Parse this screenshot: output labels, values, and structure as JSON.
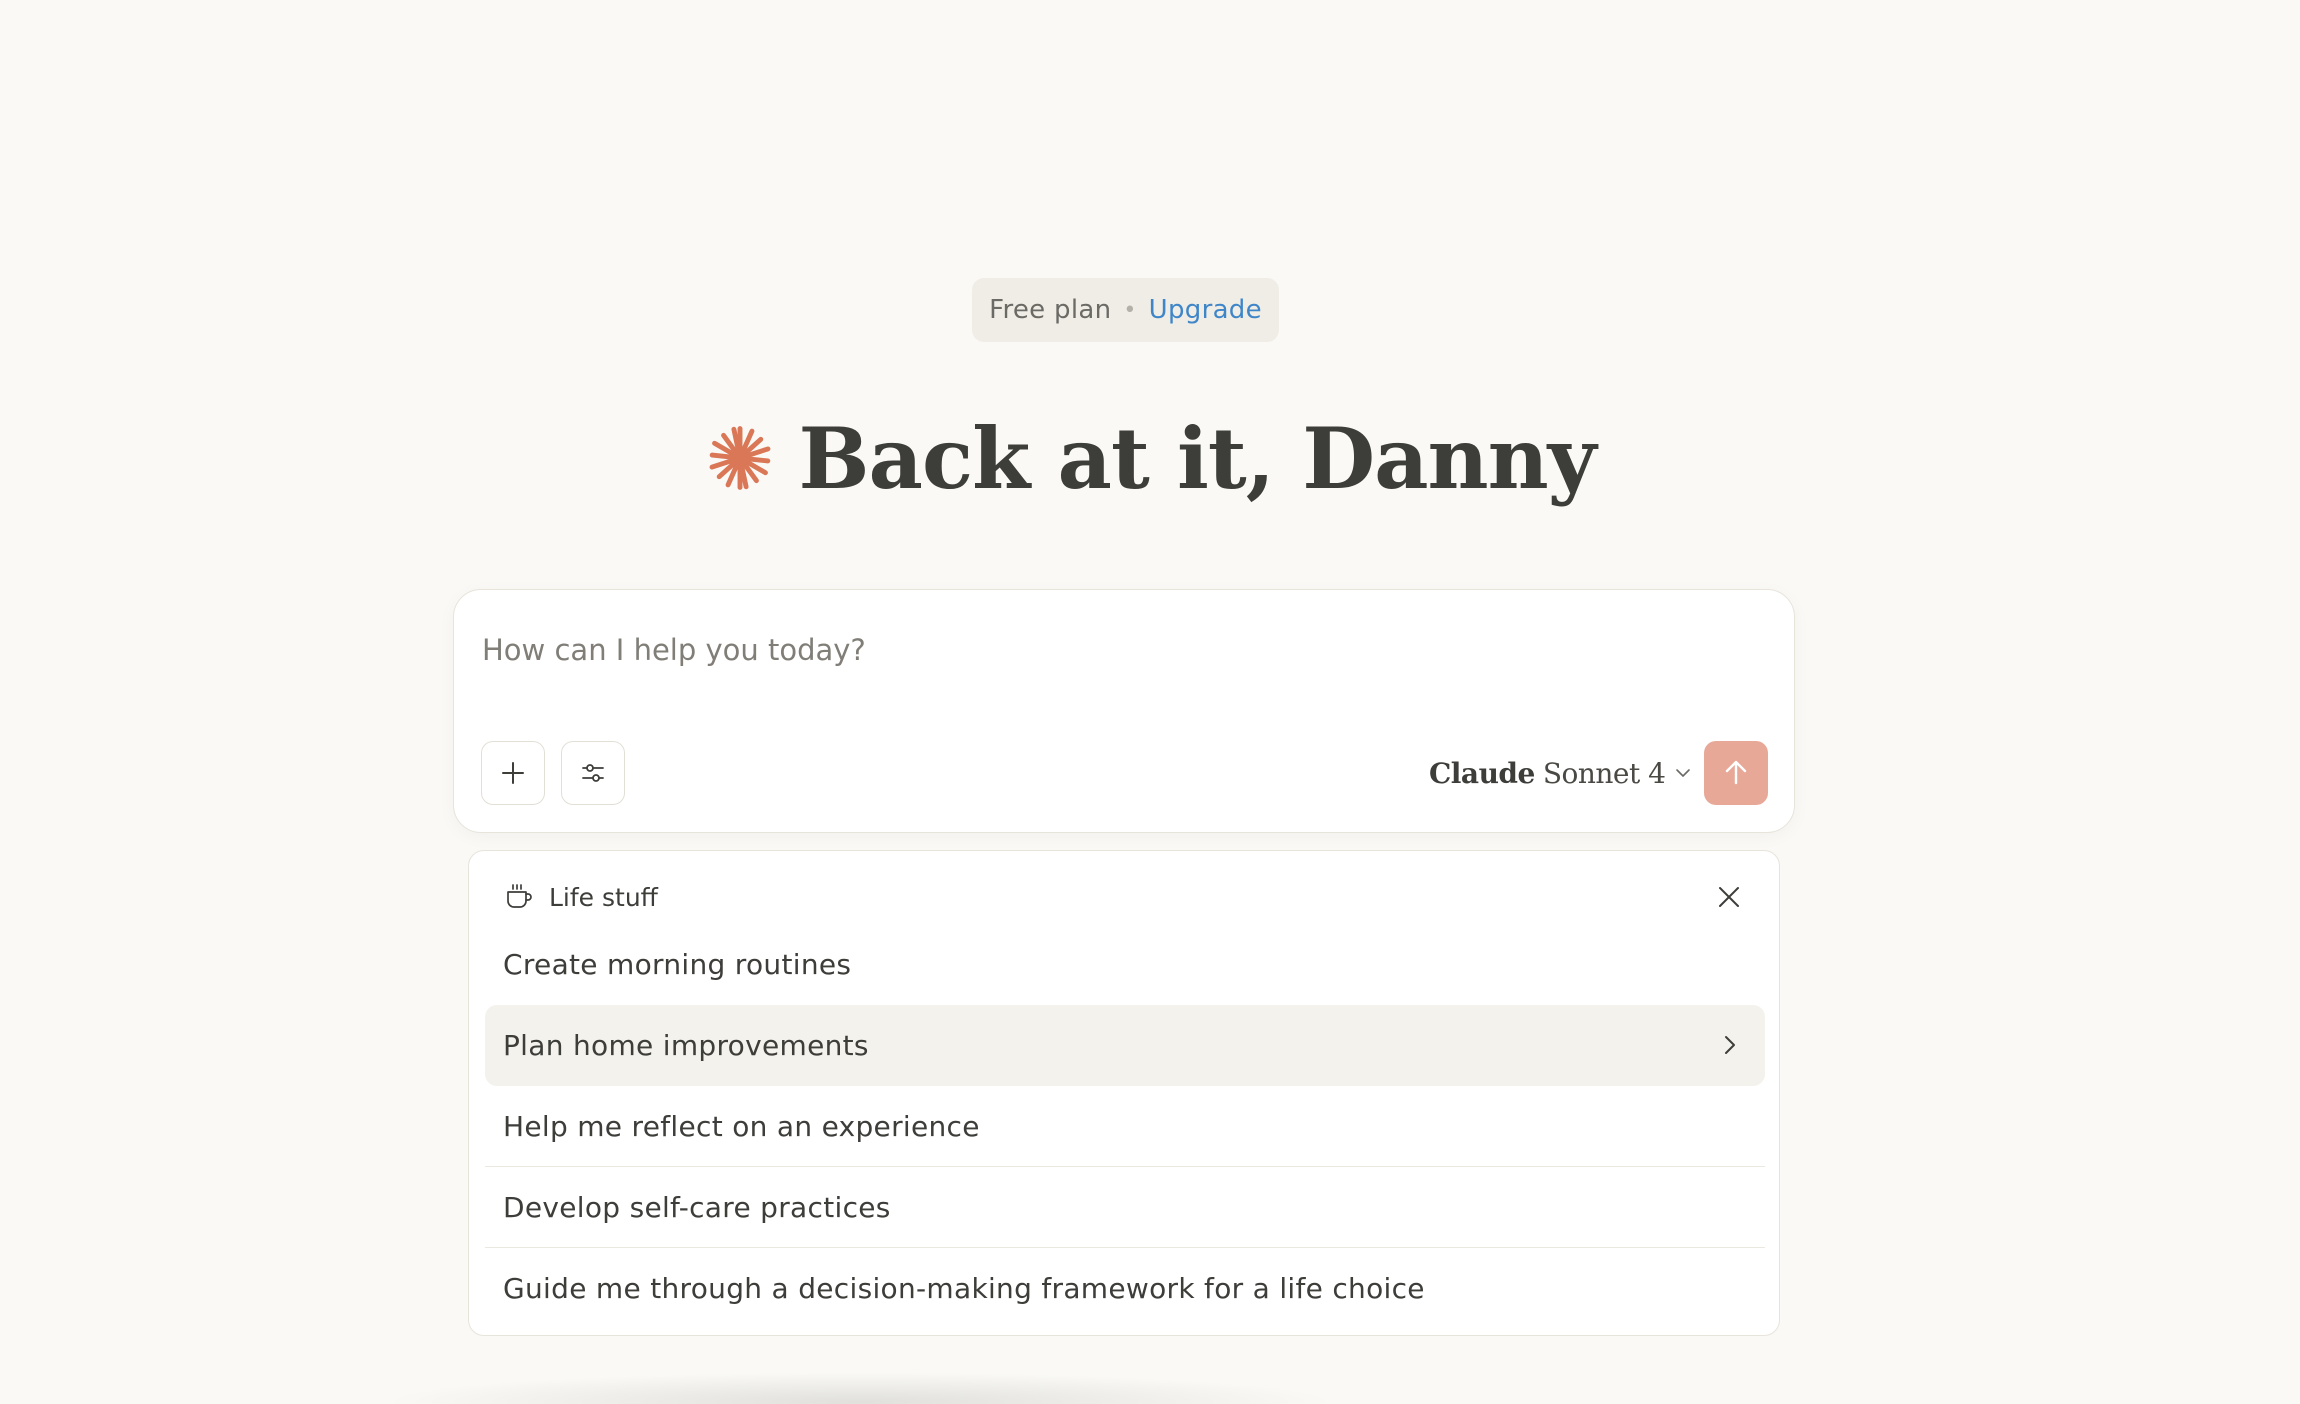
{
  "plan": {
    "label": "Free plan",
    "separator": "•",
    "upgrade": "Upgrade"
  },
  "greeting": {
    "text": "Back at it, Danny",
    "icon": "claude-spark-icon",
    "icon_color": "#d97757"
  },
  "composer": {
    "placeholder": "How can I help you today?",
    "value": "",
    "add_icon": "plus-icon",
    "settings_icon": "sliders-icon",
    "model": {
      "brand": "Claude",
      "name": "Sonnet 4",
      "icon": "chevron-down-icon"
    },
    "send_icon": "arrow-up-icon",
    "send_color": "#e8a898"
  },
  "suggestions": {
    "category": "Life stuff",
    "category_icon": "coffee-cup-icon",
    "close_icon": "close-icon",
    "items": [
      {
        "label": "Create morning routines"
      },
      {
        "label": "Plan home improvements",
        "highlighted": true
      },
      {
        "label": "Help me reflect on an experience"
      },
      {
        "label": "Develop self-care practices"
      },
      {
        "label": "Guide me through a decision-making framework for a life choice"
      }
    ]
  },
  "colors": {
    "background": "#faf9f5",
    "upgrade_link": "#3f86c9",
    "accent": "#d97757"
  }
}
